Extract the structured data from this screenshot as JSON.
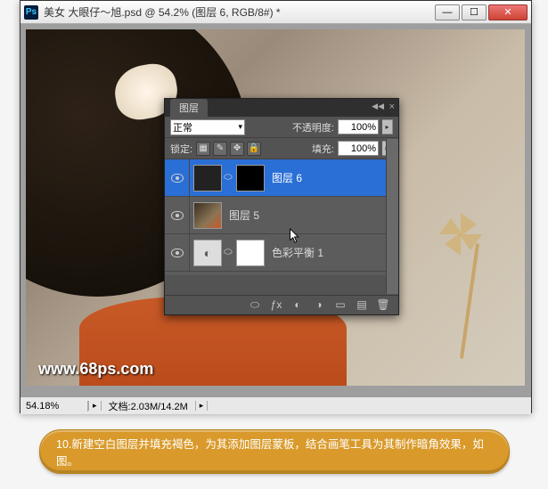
{
  "window": {
    "title": "美女 大眼仔～旭.psd @ 54.2% (图层 6, RGB/8#) *",
    "icon_text": "Ps"
  },
  "watermark": "www.68ps.com",
  "statusbar": {
    "zoom": "54.18%",
    "doc_info": "文档:2.03M/14.2M"
  },
  "panel": {
    "tab": "图层",
    "blend_mode": "正常",
    "opacity_label": "不透明度:",
    "opacity_value": "100%",
    "lock_label": "锁定:",
    "fill_label": "填充:",
    "fill_value": "100%",
    "layers": [
      {
        "name": "图层 6"
      },
      {
        "name": "图层 5"
      },
      {
        "name": "色彩平衡 1"
      }
    ]
  },
  "caption": "10.新建空白图层并填充褐色，为其添加图层蒙板，结合画笔工具为其制作暗角效果，如图。"
}
